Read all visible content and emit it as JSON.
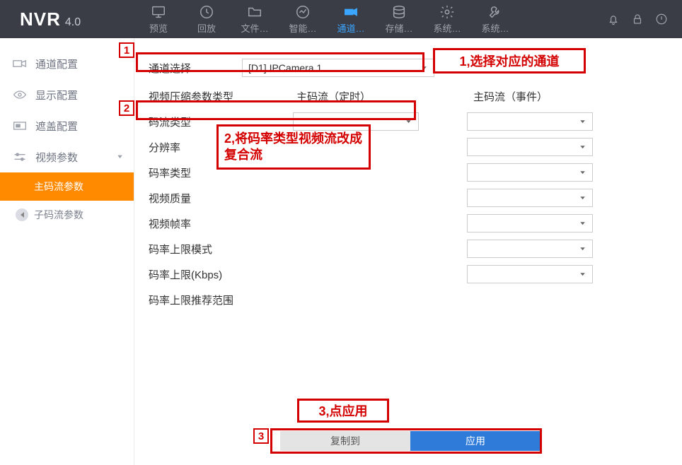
{
  "logo": {
    "main": "NVR",
    "version": "4.0"
  },
  "nav": {
    "items": [
      {
        "label": "预览"
      },
      {
        "label": "回放"
      },
      {
        "label": "文件…"
      },
      {
        "label": "智能…"
      },
      {
        "label": "通道…"
      },
      {
        "label": "存储…"
      },
      {
        "label": "系统…"
      },
      {
        "label": "系统…"
      }
    ]
  },
  "sidebar": {
    "items": [
      {
        "label": "通道配置"
      },
      {
        "label": "显示配置"
      },
      {
        "label": "遮盖配置"
      },
      {
        "label": "视频参数"
      }
    ],
    "sub": [
      {
        "label": "主码流参数"
      },
      {
        "label": "子码流参数"
      }
    ]
  },
  "form": {
    "channel_label": "通道选择",
    "channel_value": "[D1] IPCamera 1",
    "param_type_label": "视频压缩参数类型",
    "col1_header": "主码流（定时）",
    "col2_header": "主码流（事件）",
    "rows": {
      "stream_type": "码流类型",
      "resolution": "分辨率",
      "bitrate_type": "码率类型",
      "video_quality": "视频质量",
      "frame_rate": "视频帧率",
      "bitrate_limit_mode": "码率上限模式",
      "bitrate_limit_kbps": "码率上限(Kbps)",
      "bitrate_limit_range": "码率上限推荐范围"
    },
    "buttons": {
      "copy": "复制到",
      "apply": "应用"
    }
  },
  "annotations": {
    "n1": "1",
    "n1_text": "1,选择对应的通道",
    "n2": "2",
    "n2_text": "2,将码率类型视频流改成复合流",
    "n3": "3",
    "n3_text": "3,点应用"
  }
}
